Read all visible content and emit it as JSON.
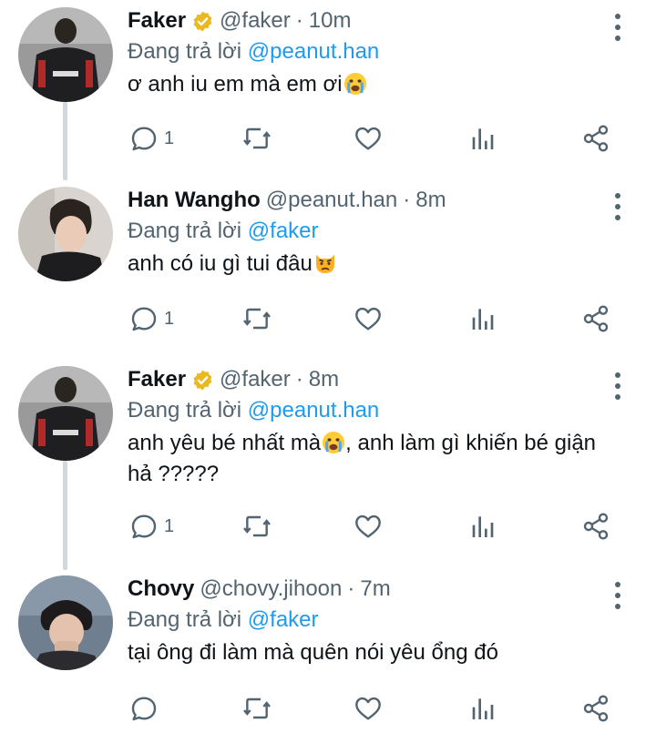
{
  "tweets": [
    {
      "name": "Faker",
      "verified": true,
      "handle": "@faker",
      "dot": "·",
      "time": "10m",
      "reply_prefix": "Đang trả lời",
      "reply_to": "@peanut.han",
      "text": "ơ anh iu em mà em ơi",
      "emoji": "crying-face",
      "reply_count": "1",
      "avatar": "faker-avatar"
    },
    {
      "name": "Han Wangho",
      "verified": false,
      "handle": "@peanut.han",
      "dot": "·",
      "time": "8m",
      "reply_prefix": "Đang trả lời",
      "reply_to": "@faker",
      "text": "anh có iu gì tui đâu",
      "emoji": "pouting-cat",
      "reply_count": "1",
      "avatar": "han-wangho-avatar"
    },
    {
      "name": "Faker",
      "verified": true,
      "handle": "@faker",
      "dot": "·",
      "time": "8m",
      "reply_prefix": "Đang trả lời",
      "reply_to": "@peanut.han",
      "text_before": "anh yêu bé nhất mà",
      "emoji": "crying-face",
      "text_after": ", anh làm gì khiến bé giận hả ?????",
      "reply_count": "1",
      "avatar": "faker-avatar"
    },
    {
      "name": "Chovy",
      "verified": false,
      "handle": "@chovy.jihoon",
      "dot": "·",
      "time": "7m",
      "reply_prefix": "Đang trả lời",
      "reply_to": "@faker",
      "text": "tại ông đi làm mà quên nói yêu ổng đó",
      "reply_count": "",
      "avatar": "chovy-avatar"
    }
  ],
  "colors": {
    "text": "#0f1419",
    "secondary": "#536471",
    "link": "#1d9bf0",
    "verified_gold": "#e8b923",
    "thread_line": "#cfd9de"
  }
}
